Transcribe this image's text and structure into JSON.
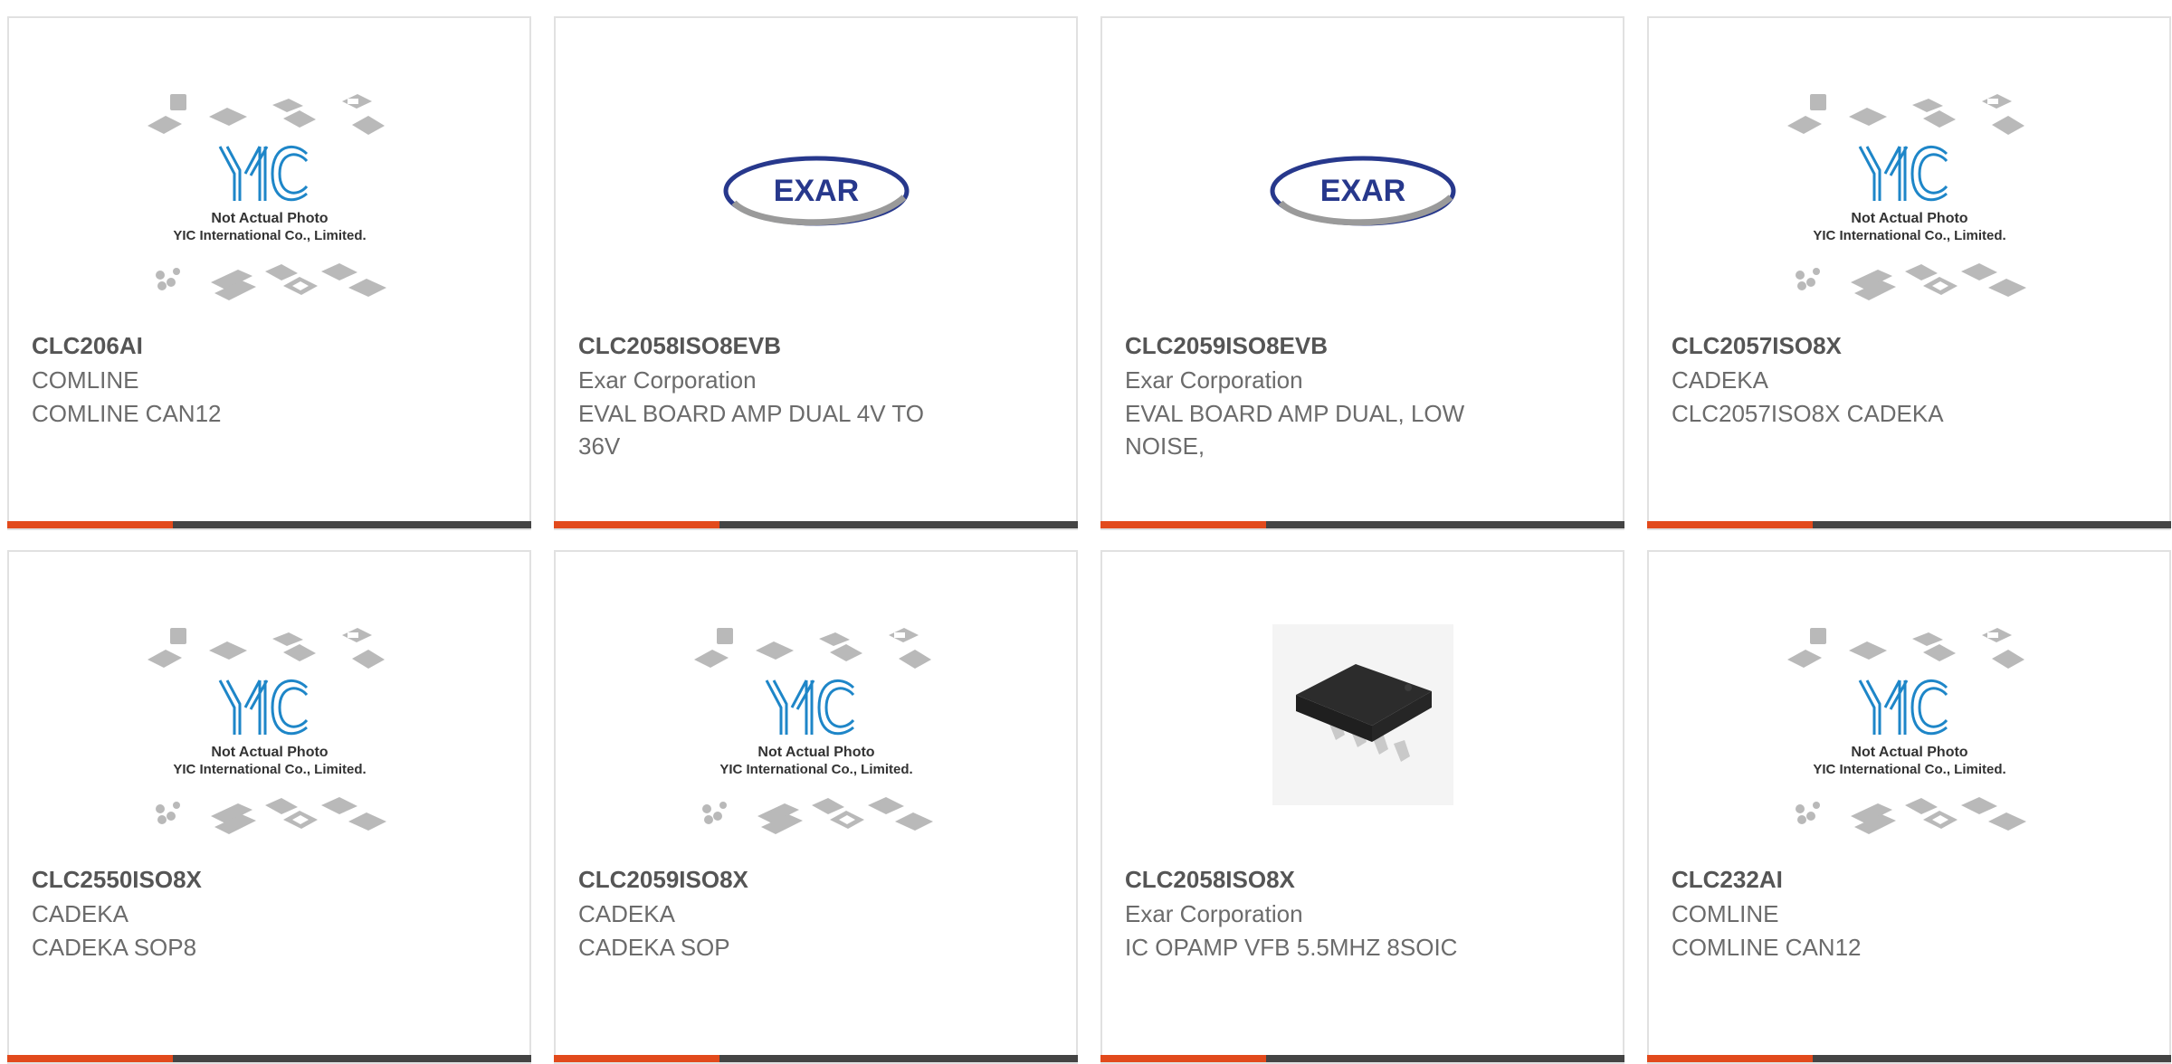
{
  "placeholder_caption": {
    "line1": "Not Actual Photo",
    "line2": "YIC International Co., Limited."
  },
  "logo": {
    "exar": "EXAR"
  },
  "colors": {
    "accent": "#e24a1c",
    "bar": "#444444",
    "border": "#e1e1e1",
    "text": "#6b6b6b",
    "exar_blue": "#27388c"
  },
  "products": [
    {
      "part_number": "CLC206AI",
      "manufacturer": "COMLINE",
      "description": "COMLINE CAN12",
      "image": "yic-placeholder"
    },
    {
      "part_number": "CLC2058ISO8EVB",
      "manufacturer": "Exar Corporation",
      "description": "EVAL BOARD AMP DUAL 4V TO 36V",
      "image": "exar-logo"
    },
    {
      "part_number": "CLC2059ISO8EVB",
      "manufacturer": "Exar Corporation",
      "description": "EVAL BOARD AMP DUAL, LOW NOISE,",
      "image": "exar-logo"
    },
    {
      "part_number": "CLC2057ISO8X",
      "manufacturer": "CADEKA",
      "description": "CLC2057ISO8X CADEKA",
      "image": "yic-placeholder"
    },
    {
      "part_number": "CLC2550ISO8X",
      "manufacturer": "CADEKA",
      "description": "CADEKA SOP8",
      "image": "yic-placeholder"
    },
    {
      "part_number": "CLC2059ISO8X",
      "manufacturer": "CADEKA",
      "description": "CADEKA SOP",
      "image": "yic-placeholder"
    },
    {
      "part_number": "CLC2058ISO8X",
      "manufacturer": "Exar Corporation",
      "description": "IC OPAMP VFB 5.5MHZ 8SOIC",
      "image": "soic-chip-photo"
    },
    {
      "part_number": "CLC232AI",
      "manufacturer": "COMLINE",
      "description": "COMLINE CAN12",
      "image": "yic-placeholder"
    }
  ]
}
